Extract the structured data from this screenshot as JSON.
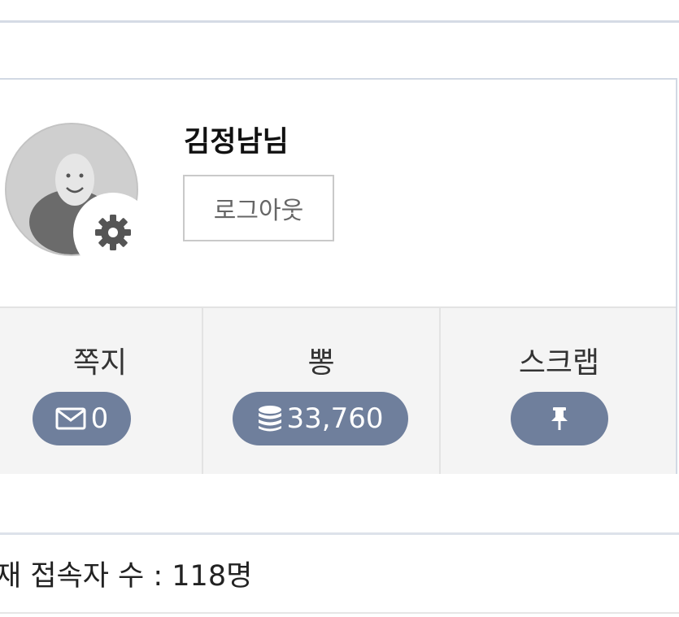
{
  "profile": {
    "username": "김정남님",
    "logout_label": "로그아웃",
    "avatar_icon": "default-user-avatar",
    "settings_icon": "gear-icon"
  },
  "stats": [
    {
      "label": "쪽지",
      "icon": "envelope-icon",
      "value": "0"
    },
    {
      "label": "뽕",
      "icon": "coin-stack-icon",
      "value": "33,760"
    },
    {
      "label": "스크랩",
      "icon": "pushpin-icon",
      "value": ""
    }
  ],
  "footer": {
    "visitors_text": "재 접속자 수 : 118명"
  },
  "colors": {
    "pill_bg": "#6f7f9c",
    "panel_border": "#d2d9e4",
    "stats_bg": "#f4f4f4"
  }
}
